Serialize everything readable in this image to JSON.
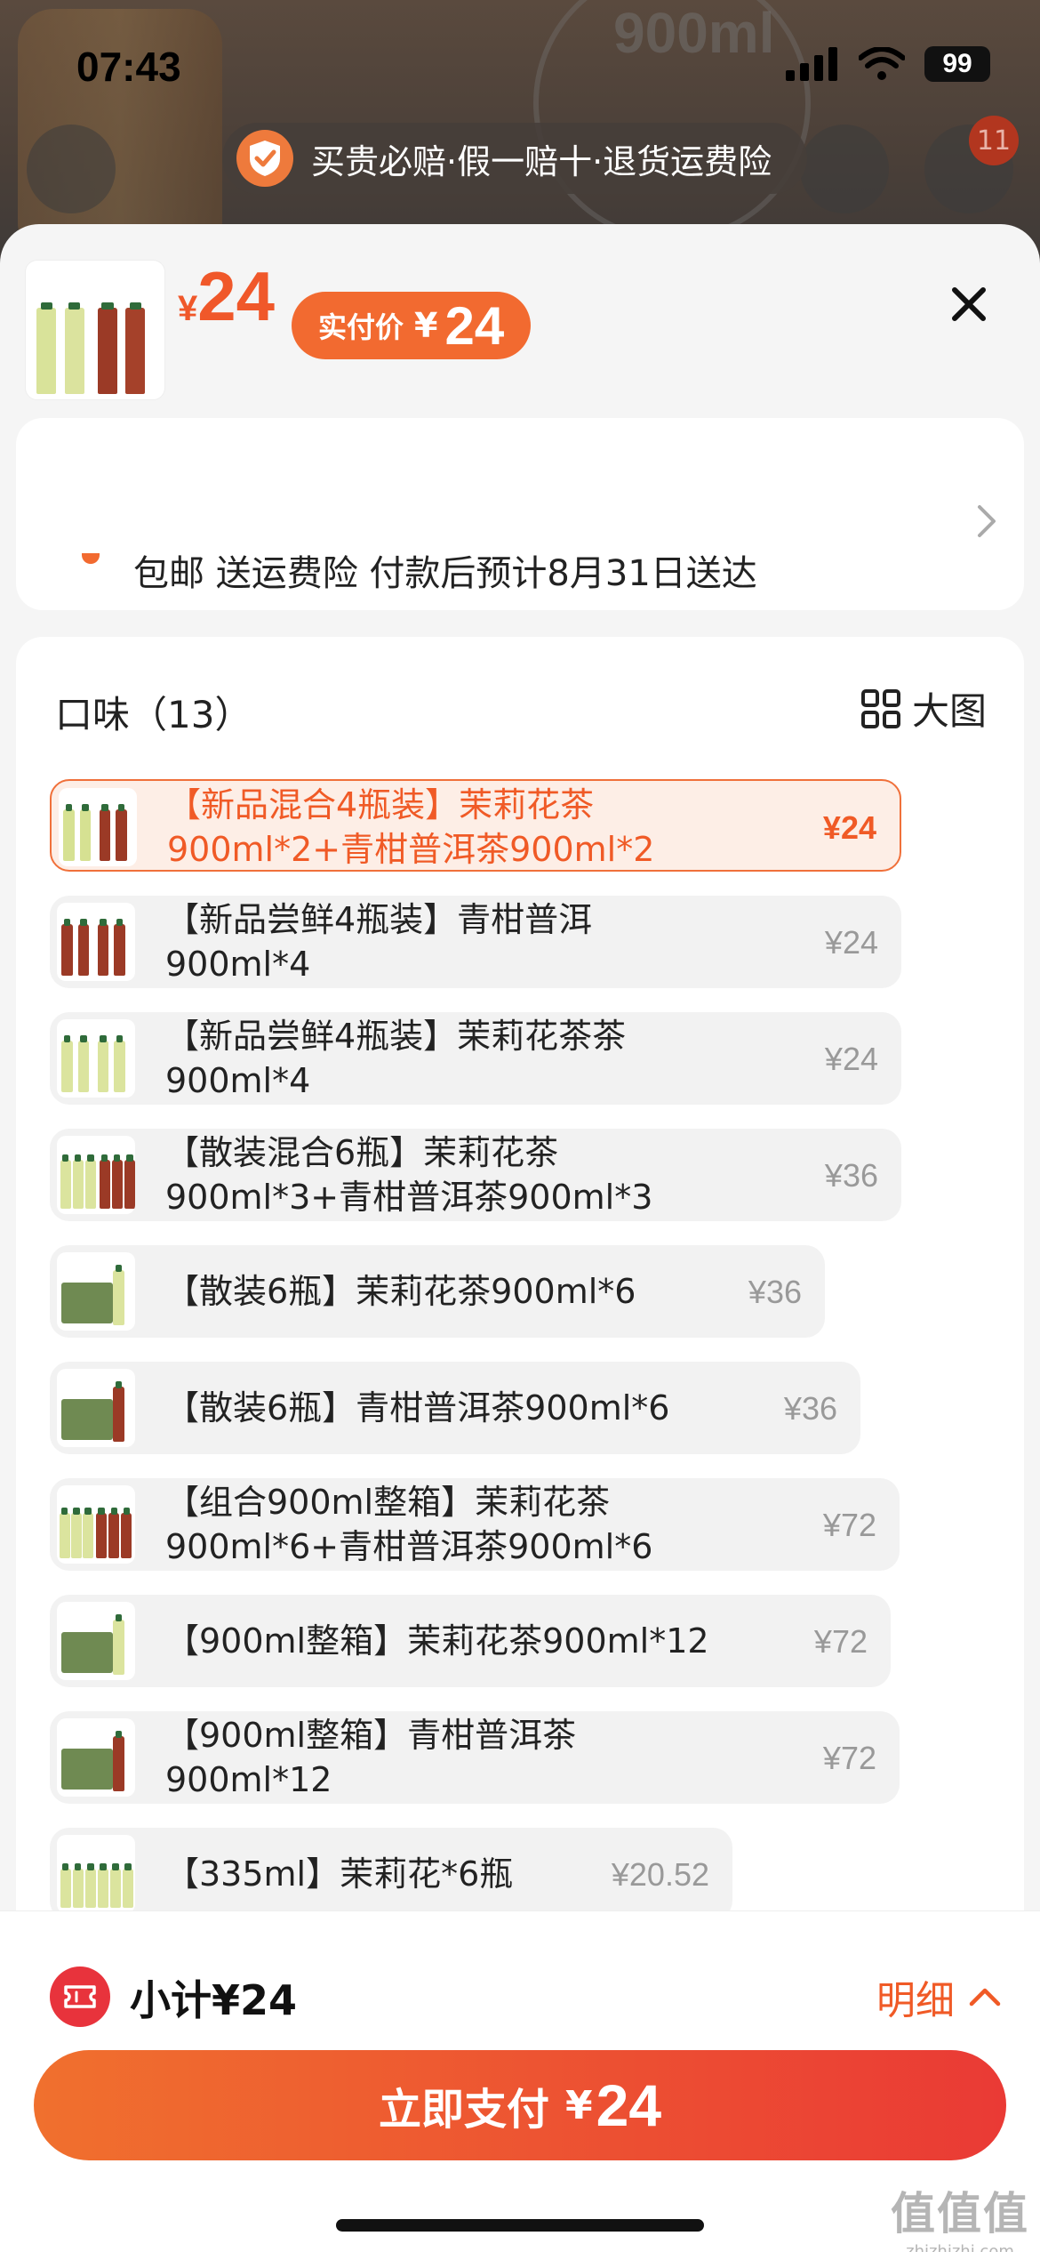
{
  "status_bar": {
    "time": "07:43",
    "battery": "99"
  },
  "background": {
    "cart_count": "11",
    "badge_text": "900ml"
  },
  "guarantee": {
    "text": "买贵必赔·假一赔十·退货运费险"
  },
  "product": {
    "price_currency": "¥",
    "price": "24",
    "actual_label": "实付价",
    "actual_currency": "¥",
    "actual_price": "24"
  },
  "shipping": {
    "text": "包邮 送运费险 付款后预计8月31日送达"
  },
  "flavor": {
    "title": "口味（13）",
    "big_view_label": "大图",
    "options": [
      {
        "name": "【新品混合4瓶装】茉莉花茶900ml*2+青柑普洱茶900ml*2",
        "price": "¥24",
        "selected": true
      },
      {
        "name": "【新品尝鲜4瓶装】青柑普洱900ml*4",
        "price": "¥24"
      },
      {
        "name": "【新品尝鲜4瓶装】茉莉花茶茶900ml*4",
        "price": "¥24"
      },
      {
        "name": "【散装混合6瓶】茉莉花茶900ml*3+青柑普洱茶900ml*3",
        "price": "¥36"
      },
      {
        "name": "【散装6瓶】茉莉花茶900ml*6",
        "price": "¥36"
      },
      {
        "name": "【散装6瓶】青柑普洱茶900ml*6",
        "price": "¥36"
      },
      {
        "name": "【组合900ml整箱】茉莉花茶900ml*6+青柑普洱茶900ml*6",
        "price": "¥72"
      },
      {
        "name": "【900ml整箱】茉莉花茶900ml*12",
        "price": "¥72"
      },
      {
        "name": "【900ml整箱】青柑普洱茶900ml*12",
        "price": "¥72"
      },
      {
        "name": "【335ml】茉莉花*6瓶",
        "price": "¥20.52"
      }
    ]
  },
  "footer": {
    "subtotal": "小计¥24",
    "detail_label": "明细",
    "pay_label": "立即支付",
    "pay_currency": "¥",
    "pay_amount": "24"
  },
  "watermark": {
    "mark": "值值值",
    "url": "zhizhizhi.com"
  },
  "colors": {
    "accent": "#f05a26",
    "pay_start": "#f0702e",
    "pay_end": "#ea3a35"
  }
}
